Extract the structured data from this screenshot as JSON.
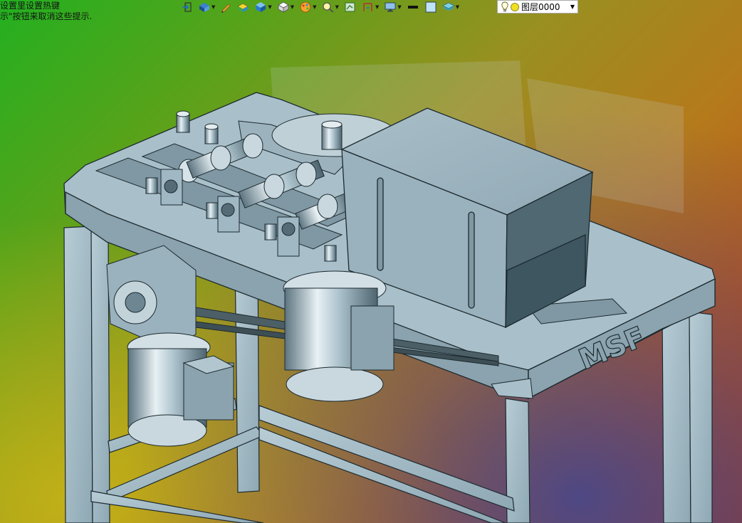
{
  "hints": {
    "line1": "设置里设置热键",
    "line2": "示\"按钮来取消这些提示."
  },
  "toolbar": {
    "items": [
      {
        "name": "exit-icon"
      },
      {
        "name": "view-orientation-icon"
      },
      {
        "name": "pencil-icon"
      },
      {
        "name": "display-style-icon"
      },
      {
        "name": "cube-icon"
      },
      {
        "name": "hide-show-icon"
      },
      {
        "name": "appearance-icon"
      },
      {
        "name": "zoom-icon"
      },
      {
        "name": "section-view-icon"
      },
      {
        "name": "measure-icon"
      },
      {
        "name": "monitor-icon"
      },
      {
        "name": "line-color-icon"
      },
      {
        "name": "fill-color-icon"
      },
      {
        "name": "layers-icon"
      }
    ]
  },
  "layer": {
    "label": "图层0000"
  },
  "model": {
    "logo_text": "MSF"
  },
  "colors": {
    "metal": "#9eb7c2",
    "metal_dark": "#6d8692",
    "metal_light": "#c8d8de",
    "edge": "#1d2a30"
  }
}
